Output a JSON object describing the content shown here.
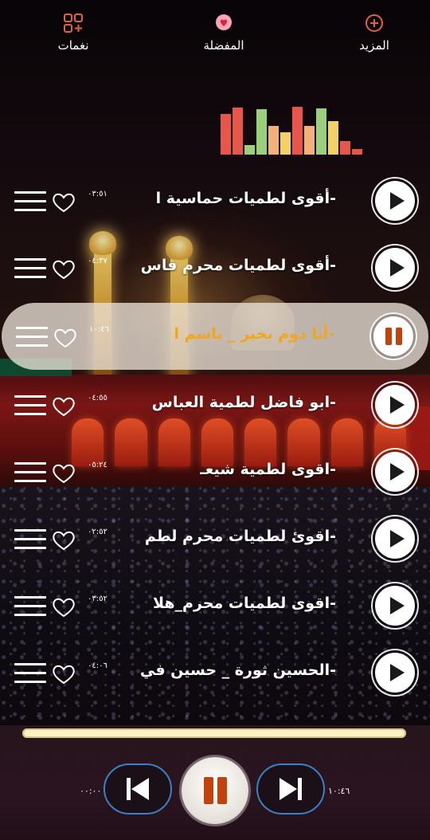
{
  "nav": {
    "ringtones_label": "نغمات",
    "favorites_label": "المفضلة",
    "more_label": "المزيد"
  },
  "colors": {
    "accent_orange": "#f0a61e",
    "pause_red": "#c2410c",
    "eq_red": "#e8564b",
    "eq_green": "#9bcf7a",
    "eq_peach": "#f2b07a",
    "eq_yellow": "#f4d06a",
    "progress": "#fdf2c4",
    "skip_border": "#3b82c4"
  },
  "equalizer": {
    "levels": [
      0.82,
      0.95,
      0.2,
      0.92,
      0.58,
      0.45,
      0.97,
      0.58,
      0.93,
      0.68,
      0.28,
      0.12
    ]
  },
  "tracks": [
    {
      "title": "-أقوى لطميات حماسية  ا",
      "duration": "٠٣:٥١",
      "playing": false
    },
    {
      "title": "-أقوى لطميات محرم  قاس",
      "duration": "٠٤:٣٧",
      "playing": false
    },
    {
      "title": "-أنا دوم بخير _ باسم ا",
      "duration": "١٠:٤٦",
      "playing": true
    },
    {
      "title": "-ابو فاضل لطمية العباس",
      "duration": "٠٤:٥٥",
      "playing": false
    },
    {
      "title": "-اقوى لطمية شيعـ",
      "duration": "٠٥:٢٤",
      "playing": false
    },
    {
      "title": "-اقوئ لطميات محرم  لطم",
      "duration": "٠٢:٥٢",
      "playing": false
    },
    {
      "title": "-اقوى لطميات محرم_هلا",
      "duration": "٠٣:٥٢",
      "playing": false
    },
    {
      "title": "-الحسين ثورة _ حسين في",
      "duration": "٠٤:٠٦",
      "playing": false
    }
  ],
  "player": {
    "elapsed": "٠٠:٠٠",
    "total": "١٠:٤٦",
    "progress": 0.0
  }
}
